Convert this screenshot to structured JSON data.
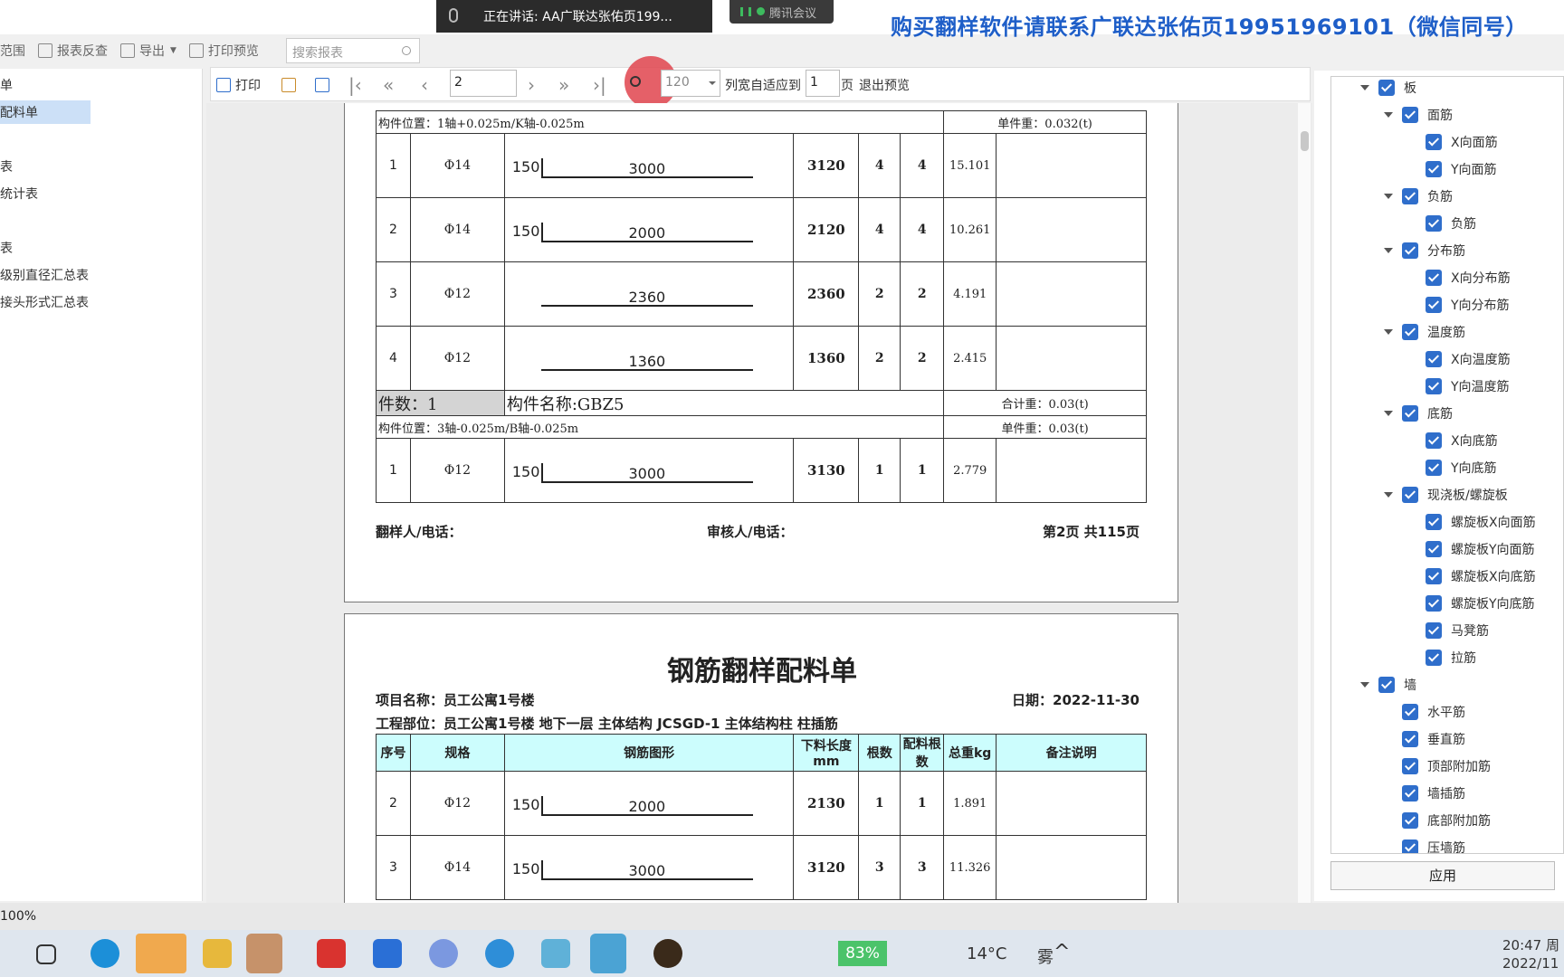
{
  "meeting": {
    "speaking": "正在讲话: AA广联达张佑页199...",
    "app": "腾讯会议"
  },
  "banner": "购买翻样软件请联系广联达张佑页19951969101（微信同号）",
  "toolbar1": {
    "range": "范围",
    "report_check": "报表反查",
    "export": "导出",
    "print_preview": "打印预览",
    "search_placeholder": "搜索报表"
  },
  "left_panel": {
    "items": [
      "单",
      "配料单",
      "表",
      "统计表",
      "表",
      "级别直径汇总表",
      "接头形式汇总表"
    ]
  },
  "preview_toolbar": {
    "print": "打印",
    "page": "2",
    "zoom": "120",
    "fit_label": "列宽自适应到",
    "fit_value": "1",
    "page_suffix": "页",
    "exit": "退出预览"
  },
  "page1": {
    "pos1": "构件位置：1轴+0.025m/K轴-0.025m",
    "unitw1": "单件重：0.032(t)",
    "rows1": [
      {
        "no": "1",
        "spec": "Φ14",
        "hook": "150",
        "len": "3000",
        "cut": "3120",
        "n": "4",
        "m": "4",
        "w": "15.101",
        "note": ""
      },
      {
        "no": "2",
        "spec": "Φ14",
        "hook": "150",
        "len": "2000",
        "cut": "2120",
        "n": "4",
        "m": "4",
        "w": "10.261",
        "note": ""
      },
      {
        "no": "3",
        "spec": "Φ12",
        "hook": "",
        "len": "2360",
        "cut": "2360",
        "n": "2",
        "m": "2",
        "w": "4.191",
        "note": ""
      },
      {
        "no": "4",
        "spec": "Φ12",
        "hook": "",
        "len": "1360",
        "cut": "1360",
        "n": "2",
        "m": "2",
        "w": "2.415",
        "note": ""
      }
    ],
    "count": "件数：1",
    "compname": "构件名称:GBZ5",
    "total": "合计重：0.03(t)",
    "pos2": "构件位置：3轴-0.025m/B轴-0.025m",
    "unitw2": "单件重：0.03(t)",
    "rows2": [
      {
        "no": "1",
        "spec": "Φ12",
        "hook": "150",
        "len": "3000",
        "cut": "3130",
        "n": "1",
        "m": "1",
        "w": "2.779",
        "note": ""
      }
    ],
    "footer": {
      "maker": "翻样人/电话：",
      "reviewer": "审核人/电话：",
      "pageinfo": "第2页 共115页"
    }
  },
  "page2": {
    "title": "钢筋翻样配料单",
    "project": "项目名称：员工公寓1号楼",
    "date": "日期：2022-11-30",
    "part": "工程部位：员工公寓1号楼 地下一层 主体结构 JCSGD-1 主体结构柱 柱插筋",
    "headers": [
      "序号",
      "规格",
      "钢筋图形",
      "下料长度mm",
      "根数",
      "配料根数",
      "总重kg",
      "备注说明"
    ],
    "rows": [
      {
        "no": "2",
        "spec": "Φ12",
        "hook": "150",
        "len": "2000",
        "cut": "2130",
        "n": "1",
        "m": "1",
        "w": "1.891",
        "note": ""
      },
      {
        "no": "3",
        "spec": "Φ14",
        "hook": "150",
        "len": "3000",
        "cut": "3120",
        "n": "3",
        "m": "3",
        "w": "11.326",
        "note": ""
      }
    ]
  },
  "tree": [
    {
      "label": "板",
      "level": 0,
      "expand": true
    },
    {
      "label": "面筋",
      "level": 1,
      "expand": true
    },
    {
      "label": "X向面筋",
      "level": 2
    },
    {
      "label": "Y向面筋",
      "level": 2
    },
    {
      "label": "负筋",
      "level": 1,
      "expand": true
    },
    {
      "label": "负筋",
      "level": 2
    },
    {
      "label": "分布筋",
      "level": 1,
      "expand": true
    },
    {
      "label": "X向分布筋",
      "level": 2
    },
    {
      "label": "Y向分布筋",
      "level": 2
    },
    {
      "label": "温度筋",
      "level": 1,
      "expand": true
    },
    {
      "label": "X向温度筋",
      "level": 2
    },
    {
      "label": "Y向温度筋",
      "level": 2
    },
    {
      "label": "底筋",
      "level": 1,
      "expand": true
    },
    {
      "label": "X向底筋",
      "level": 2
    },
    {
      "label": "Y向底筋",
      "level": 2
    },
    {
      "label": "现浇板/螺旋板",
      "level": 1,
      "expand": true
    },
    {
      "label": "螺旋板X向面筋",
      "level": 2
    },
    {
      "label": "螺旋板Y向面筋",
      "level": 2
    },
    {
      "label": "螺旋板X向底筋",
      "level": 2
    },
    {
      "label": "螺旋板Y向底筋",
      "level": 2
    },
    {
      "label": "马凳筋",
      "level": 2
    },
    {
      "label": "拉筋",
      "level": 2
    },
    {
      "label": "墙",
      "level": 0,
      "expand": true
    },
    {
      "label": "水平筋",
      "level": 1
    },
    {
      "label": "垂直筋",
      "level": 1
    },
    {
      "label": "顶部附加筋",
      "level": 1
    },
    {
      "label": "墙插筋",
      "level": 1
    },
    {
      "label": "底部附加筋",
      "level": 1
    },
    {
      "label": "压墙筋",
      "level": 1
    }
  ],
  "apply": "应用",
  "status": {
    "zoom": "100%"
  },
  "taskbar": {
    "battery": "83%",
    "temp": "14°C",
    "weather": "雾",
    "time": "20:47 周",
    "date": "2022/11"
  }
}
